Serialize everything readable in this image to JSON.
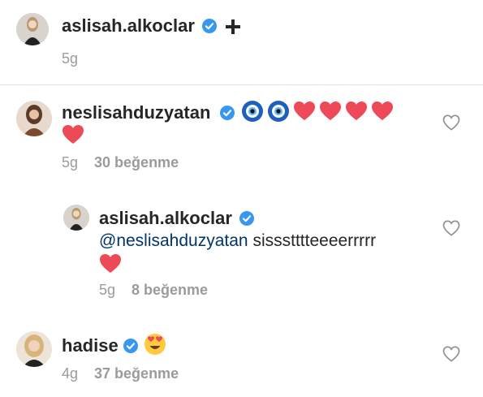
{
  "post": {
    "username": "aslisah.alkoclar",
    "time": "5g"
  },
  "comments": [
    {
      "username": "neslisahduzyatan",
      "emojis": [
        "nazar-amulet-icon",
        "nazar-amulet-icon",
        "red-heart-icon",
        "red-heart-icon",
        "red-heart-icon",
        "red-heart-icon",
        "red-heart-icon"
      ],
      "time": "5g",
      "likes": "30 beğenme"
    },
    {
      "username": "aslisah.alkoclar",
      "mention": "@neslisahduzyatan",
      "text": "sissstttteeeerrrrr",
      "emojis": [
        "red-heart-icon"
      ],
      "time": "5g",
      "likes": "8 beğenme"
    },
    {
      "username": "hadise",
      "emojis": [
        "heart-eyes-face-icon"
      ],
      "time": "4g",
      "likes": "37 beğenme"
    }
  ],
  "colors": {
    "verified": "#3897f0",
    "heart": "#ed4956",
    "nazar_blue": "#1f5fbf",
    "muted_text": "#9b9b9b",
    "mention": "#003569"
  }
}
